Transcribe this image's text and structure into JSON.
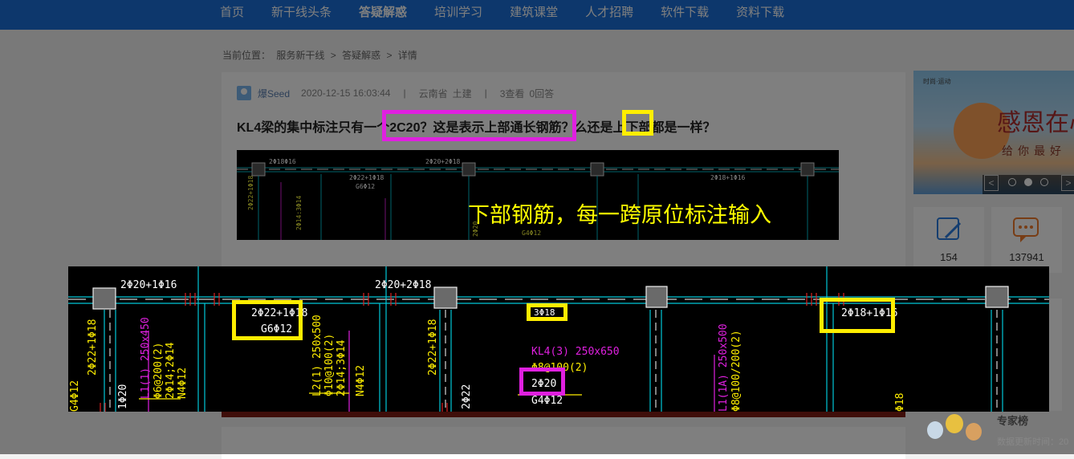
{
  "nav": [
    "首页",
    "新干线头条",
    "答疑解惑",
    "培训学习",
    "建筑课堂",
    "人才招聘",
    "软件下载",
    "资料下载"
  ],
  "breadcrumb": [
    "当前位置：",
    "服务新干线",
    ">",
    "答疑解惑",
    ">",
    "详情"
  ],
  "question": {
    "user": "爆Seed",
    "datetime": "2020-12-15 16:03:44",
    "sep": "|",
    "region": "云南省",
    "major": "土建",
    "views": "3查看",
    "answers": "0回答",
    "title": "KL4梁的集中标注只有一个2C20？这是表示上部通长钢筋？么还是上下部都是一样？"
  },
  "caption": "下部钢筋，每一跨原位标注输入",
  "sidebar": {
    "banner_line1": "感恩在心",
    "banner_line2": "给你最好",
    "banner_small": "时尚·运动",
    "arrow_left": "<",
    "arrow_right": ">",
    "stat1": "154",
    "stat2": "137941",
    "expert_title": "专家榜",
    "expert_sub": "数据更新时间：20"
  },
  "cad_small_labels": [
    "2Φ18Φ16",
    "2Φ20+2Φ18",
    "2Φ18+1Φ16",
    "2Φ22+1Φ18",
    "G6Φ12",
    "2Φ22+1Φ18",
    "2Φ14:3Φ14",
    "2Φ20",
    "G4Φ12"
  ],
  "cad_labels": {
    "top1": "2Φ20+1Φ16",
    "top2": "2Φ20+2Φ18",
    "box1a": "2Φ22+1Φ18",
    "box1b": "G6Φ12",
    "box3": "2Φ18+1Φ16",
    "box_small": "3Φ18",
    "kl4": "KL4(3) 250x650",
    "stirrup": "Φ8@100(2)",
    "box_2c20": "2Φ20",
    "g4": "G4Φ12",
    "v1": "2Φ22+1Φ18",
    "v2": "L1(1) 250x450",
    "v3": "Φ6@200(2)",
    "v4": "2Φ14;2Φ14",
    "v5": "N4Φ12",
    "v6": "L2(1) 250x500",
    "v7": "Φ10@100(2)",
    "v8": "2Φ14;3Φ14",
    "v9": "N4Φ12",
    "v10": "2Φ22+1Φ18",
    "v11": "2Φ22",
    "v12": "1Φ20",
    "v13": "G4Φ12",
    "v14": "L1(1A) 250x500",
    "v15": "Φ8@100/200(2)",
    "v16": "Φ18"
  },
  "colors": {
    "nav": "#1b6fd8",
    "magenta": "#e020e0",
    "yellow": "#ffee00",
    "cyan": "#00c8d8"
  }
}
